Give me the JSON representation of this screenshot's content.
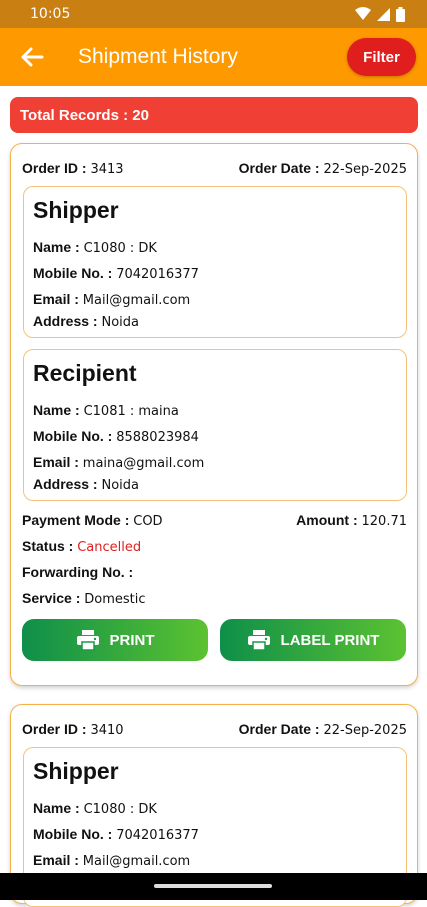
{
  "status_bar": {
    "time": "10:05"
  },
  "app_bar": {
    "title": "Shipment History",
    "filter_label": "Filter"
  },
  "summary": {
    "total_records": "Total Records : 20"
  },
  "orders": [
    {
      "order_id_label": "Order ID :",
      "order_id": "3413",
      "order_date_label": "Order Date :",
      "order_date": "22-Sep-2025",
      "shipper": {
        "heading": "Shipper",
        "name_label": "Name :",
        "name": "C1080 : DK",
        "mobile_label": "Mobile No. :",
        "mobile": "7042016377",
        "email_label": "Email :",
        "email": "Mail@gmail.com",
        "address_label": "Address :",
        "address": "Noida"
      },
      "recipient": {
        "heading": "Recipient",
        "name_label": "Name :",
        "name": "C1081 : maina",
        "mobile_label": "Mobile No. :",
        "mobile": "8588023984",
        "email_label": "Email :",
        "email": "maina@gmail.com",
        "address_label": "Address :",
        "address": "Noida"
      },
      "payment_mode_label": "Payment Mode :",
      "payment_mode": "COD",
      "amount_label": "Amount :",
      "amount": "120.71",
      "status_label": "Status :",
      "status": "Cancelled",
      "forwarding_label": "Forwarding No. :",
      "forwarding": "",
      "service_label": "Service :",
      "service": "Domestic",
      "print_label": "PRINT",
      "label_print_label": "LABEL PRINT"
    },
    {
      "order_id_label": "Order ID :",
      "order_id": "3410",
      "order_date_label": "Order Date :",
      "order_date": "22-Sep-2025",
      "shipper": {
        "heading": "Shipper",
        "name_label": "Name :",
        "name": "C1080 : DK",
        "mobile_label": "Mobile No. :",
        "mobile": "7042016377",
        "email_label": "Email :",
        "email": "Mail@gmail.com"
      }
    }
  ],
  "colors": {
    "appbar": "#ff9900",
    "filter": "#e01e1e",
    "total_banner": "#f04035",
    "card_border": "#f6b04a",
    "button_start": "#0e8f4a",
    "button_end": "#5cc231",
    "status_cancelled": "#e01e1e"
  }
}
